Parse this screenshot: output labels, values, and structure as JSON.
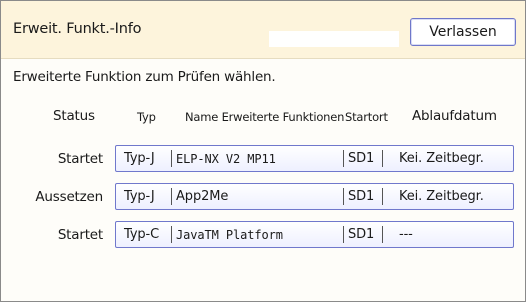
{
  "header": {
    "title": "Erweit. Funkt.-Info",
    "exit_label": "Verlassen"
  },
  "instruction": "Erweiterte Funktion zum Prüfen wählen.",
  "table": {
    "columns": {
      "status": "Status",
      "type": "Typ",
      "name": "Name Erweiterte Funktionen",
      "startup": "Startort",
      "expiry": "Ablaufdatum"
    },
    "rows": [
      {
        "status": "Startet",
        "type": "Typ-J",
        "name": "ELP-NX V2 MP11",
        "startup": "SD1",
        "expiry": "Kei. Zeitbegr."
      },
      {
        "status": "Aussetzen",
        "type": "Typ-J",
        "name": "App2Me",
        "startup": "SD1",
        "expiry": "Kei. Zeitbegr."
      },
      {
        "status": "Startet",
        "type": "Typ-C",
        "name": "JavaTM Platform",
        "startup": "SD1",
        "expiry": "---"
      }
    ]
  }
}
